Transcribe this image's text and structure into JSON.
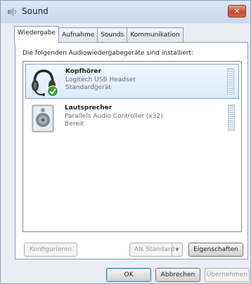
{
  "window": {
    "title": "Sound",
    "close_label": "✕"
  },
  "tabs": [
    {
      "label": "Wiedergabe",
      "active": true
    },
    {
      "label": "Aufnahme",
      "active": false
    },
    {
      "label": "Sounds",
      "active": false
    },
    {
      "label": "Kommunikation",
      "active": false
    }
  ],
  "panel": {
    "intro": "Die folgenden Audiowiedergabegeräte sind installiert:"
  },
  "devices": [
    {
      "name": "Kopfhörer",
      "description": "Logitech USB Headset",
      "status": "Standardgerät",
      "icon": "headset-icon",
      "default_badge": "check-badge-icon",
      "selected": true
    },
    {
      "name": "Lautsprecher",
      "description": "Parallels Audio Controller (x32)",
      "status": "Bereit",
      "icon": "speaker-icon",
      "selected": false
    }
  ],
  "panel_buttons": {
    "configure": "Konfigurieren",
    "set_default": "Als Standard",
    "properties": "Eigenschaften"
  },
  "dialog_buttons": {
    "ok": "OK",
    "cancel": "Abbrechen",
    "apply": "Übernehmen"
  },
  "colors": {
    "selection": "#dcebfc",
    "selection_border": "#7da2ce",
    "default_check": "#3aa53a",
    "close_button": "#c84a31"
  }
}
